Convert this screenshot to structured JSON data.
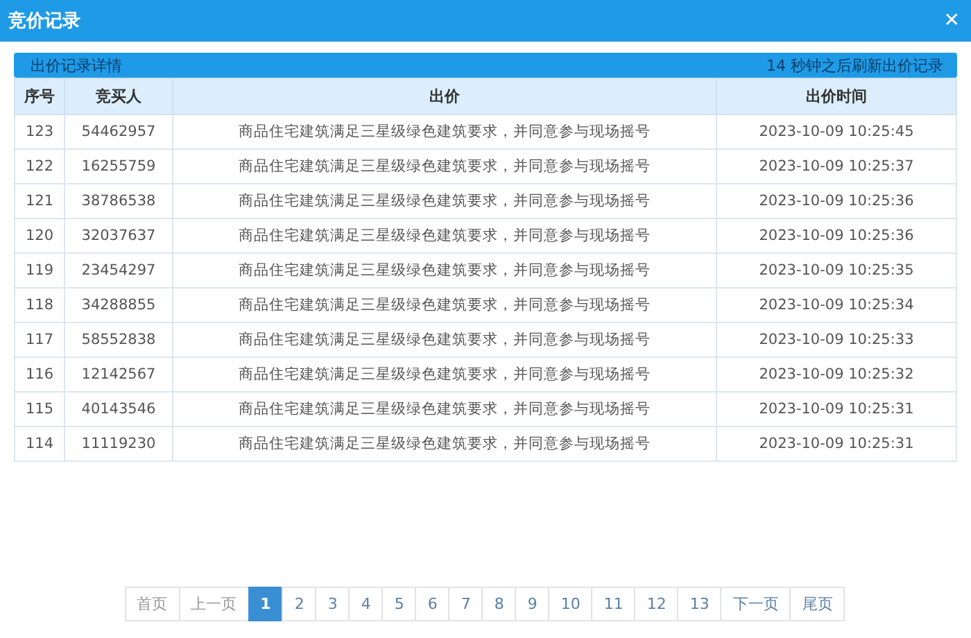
{
  "window": {
    "title": "竞价记录",
    "close": "✕"
  },
  "panel": {
    "title": "出价记录详情",
    "refresh_note": "14 秒钟之后刷新出价记录"
  },
  "table": {
    "columns": [
      "序号",
      "竞买人",
      "出价",
      "出价时间"
    ],
    "rows": [
      [
        "123",
        "54462957",
        "商品住宅建筑满足三星级绿色建筑要求，并同意参与现场摇号",
        "2023-10-09 10:25:45"
      ],
      [
        "122",
        "16255759",
        "商品住宅建筑满足三星级绿色建筑要求，并同意参与现场摇号",
        "2023-10-09 10:25:37"
      ],
      [
        "121",
        "38786538",
        "商品住宅建筑满足三星级绿色建筑要求，并同意参与现场摇号",
        "2023-10-09 10:25:36"
      ],
      [
        "120",
        "32037637",
        "商品住宅建筑满足三星级绿色建筑要求，并同意参与现场摇号",
        "2023-10-09 10:25:36"
      ],
      [
        "119",
        "23454297",
        "商品住宅建筑满足三星级绿色建筑要求，并同意参与现场摇号",
        "2023-10-09 10:25:35"
      ],
      [
        "118",
        "34288855",
        "商品住宅建筑满足三星级绿色建筑要求，并同意参与现场摇号",
        "2023-10-09 10:25:34"
      ],
      [
        "117",
        "58552838",
        "商品住宅建筑满足三星级绿色建筑要求，并同意参与现场摇号",
        "2023-10-09 10:25:33"
      ],
      [
        "116",
        "12142567",
        "商品住宅建筑满足三星级绿色建筑要求，并同意参与现场摇号",
        "2023-10-09 10:25:32"
      ],
      [
        "115",
        "40143546",
        "商品住宅建筑满足三星级绿色建筑要求，并同意参与现场摇号",
        "2023-10-09 10:25:31"
      ],
      [
        "114",
        "11119230",
        "商品住宅建筑满足三星级绿色建筑要求，并同意参与现场摇号",
        "2023-10-09 10:25:31"
      ]
    ]
  },
  "pagination": [
    {
      "label": "首页",
      "selected": false,
      "disabled": true
    },
    {
      "label": "上一页",
      "selected": false,
      "disabled": true
    },
    {
      "label": "1",
      "selected": true,
      "disabled": false
    },
    {
      "label": "2",
      "selected": false,
      "disabled": false
    },
    {
      "label": "3",
      "selected": false,
      "disabled": false
    },
    {
      "label": "4",
      "selected": false,
      "disabled": false
    },
    {
      "label": "5",
      "selected": false,
      "disabled": false
    },
    {
      "label": "6",
      "selected": false,
      "disabled": false
    },
    {
      "label": "7",
      "selected": false,
      "disabled": false
    },
    {
      "label": "8",
      "selected": false,
      "disabled": false
    },
    {
      "label": "9",
      "selected": false,
      "disabled": false
    },
    {
      "label": "10",
      "selected": false,
      "disabled": false
    },
    {
      "label": "11",
      "selected": false,
      "disabled": false
    },
    {
      "label": "12",
      "selected": false,
      "disabled": false
    },
    {
      "label": "13",
      "selected": false,
      "disabled": false
    },
    {
      "label": "下一页",
      "selected": false,
      "disabled": false
    },
    {
      "label": "尾页",
      "selected": false,
      "disabled": false
    }
  ]
}
